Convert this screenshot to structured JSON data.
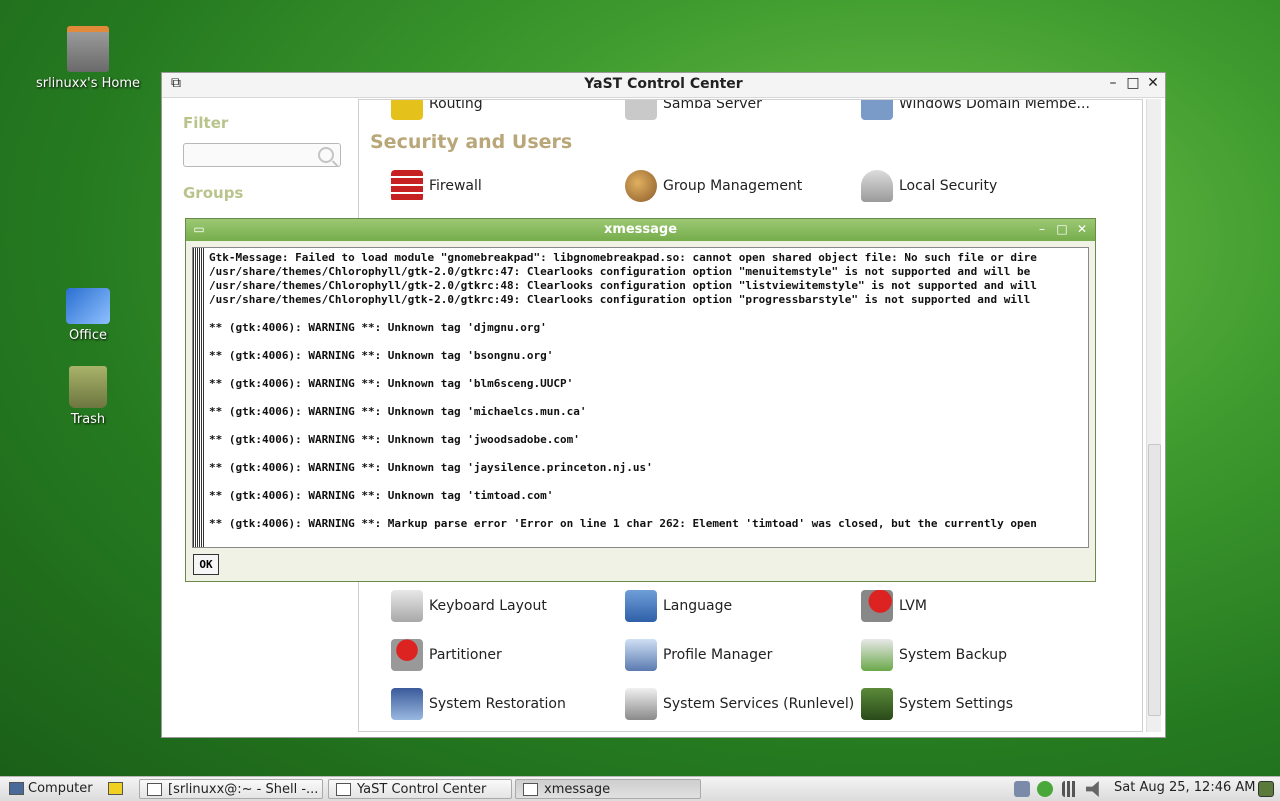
{
  "desktop": {
    "icons": [
      {
        "label": "srlinuxx's Home"
      },
      {
        "label": "Office"
      },
      {
        "label": "Trash"
      }
    ]
  },
  "yast": {
    "title": "YaST Control Center",
    "sidebar": {
      "filter_label": "Filter",
      "filter_value": "",
      "groups_label": "Groups"
    },
    "partial_top_row": [
      "Routing",
      "Samba Server",
      "Windows Domain Membe..."
    ],
    "section_title": "Security and Users",
    "security_modules": [
      "Firewall",
      "Group Management",
      "Local Security"
    ],
    "system_modules": [
      "Keyboard Layout",
      "Language",
      "LVM",
      "Partitioner",
      "Profile Manager",
      "System Backup",
      "System Restoration",
      "System Services (Runlevel)",
      "System Settings"
    ]
  },
  "xmessage": {
    "title": "xmessage",
    "lines": [
      "Gtk-Message: Failed to load module \"gnomebreakpad\": libgnomebreakpad.so: cannot open shared object file: No such file or dire",
      "/usr/share/themes/Chlorophyll/gtk-2.0/gtkrc:47: Clearlooks configuration option \"menuitemstyle\" is not supported and will be",
      "/usr/share/themes/Chlorophyll/gtk-2.0/gtkrc:48: Clearlooks configuration option \"listviewitemstyle\" is not supported and will",
      "/usr/share/themes/Chlorophyll/gtk-2.0/gtkrc:49: Clearlooks configuration option \"progressbarstyle\" is not supported and will",
      "",
      "** (gtk:4006): WARNING **: Unknown tag 'djmgnu.org'",
      "",
      "** (gtk:4006): WARNING **: Unknown tag 'bsongnu.org'",
      "",
      "** (gtk:4006): WARNING **: Unknown tag 'blm6sceng.UUCP'",
      "",
      "** (gtk:4006): WARNING **: Unknown tag 'michaelcs.mun.ca'",
      "",
      "** (gtk:4006): WARNING **: Unknown tag 'jwoodsadobe.com'",
      "",
      "** (gtk:4006): WARNING **: Unknown tag 'jaysilence.princeton.nj.us'",
      "",
      "** (gtk:4006): WARNING **: Unknown tag 'timtoad.com'",
      "",
      "** (gtk:4006): WARNING **: Markup parse error 'Error on line 1 char 262: Element 'timtoad' was closed, but the currently open"
    ],
    "ok_label": "OK"
  },
  "taskbar": {
    "menu_label": "Computer",
    "tasks": [
      "[srlinuxx@:~ - Shell -...",
      "YaST Control Center",
      "xmessage"
    ],
    "clock": "Sat Aug 25, 12:46 AM"
  },
  "colors": {
    "desktop_green": "#3e9a2e",
    "xmessage_title": "#76ad4c",
    "section_title": "#b9a77a"
  }
}
